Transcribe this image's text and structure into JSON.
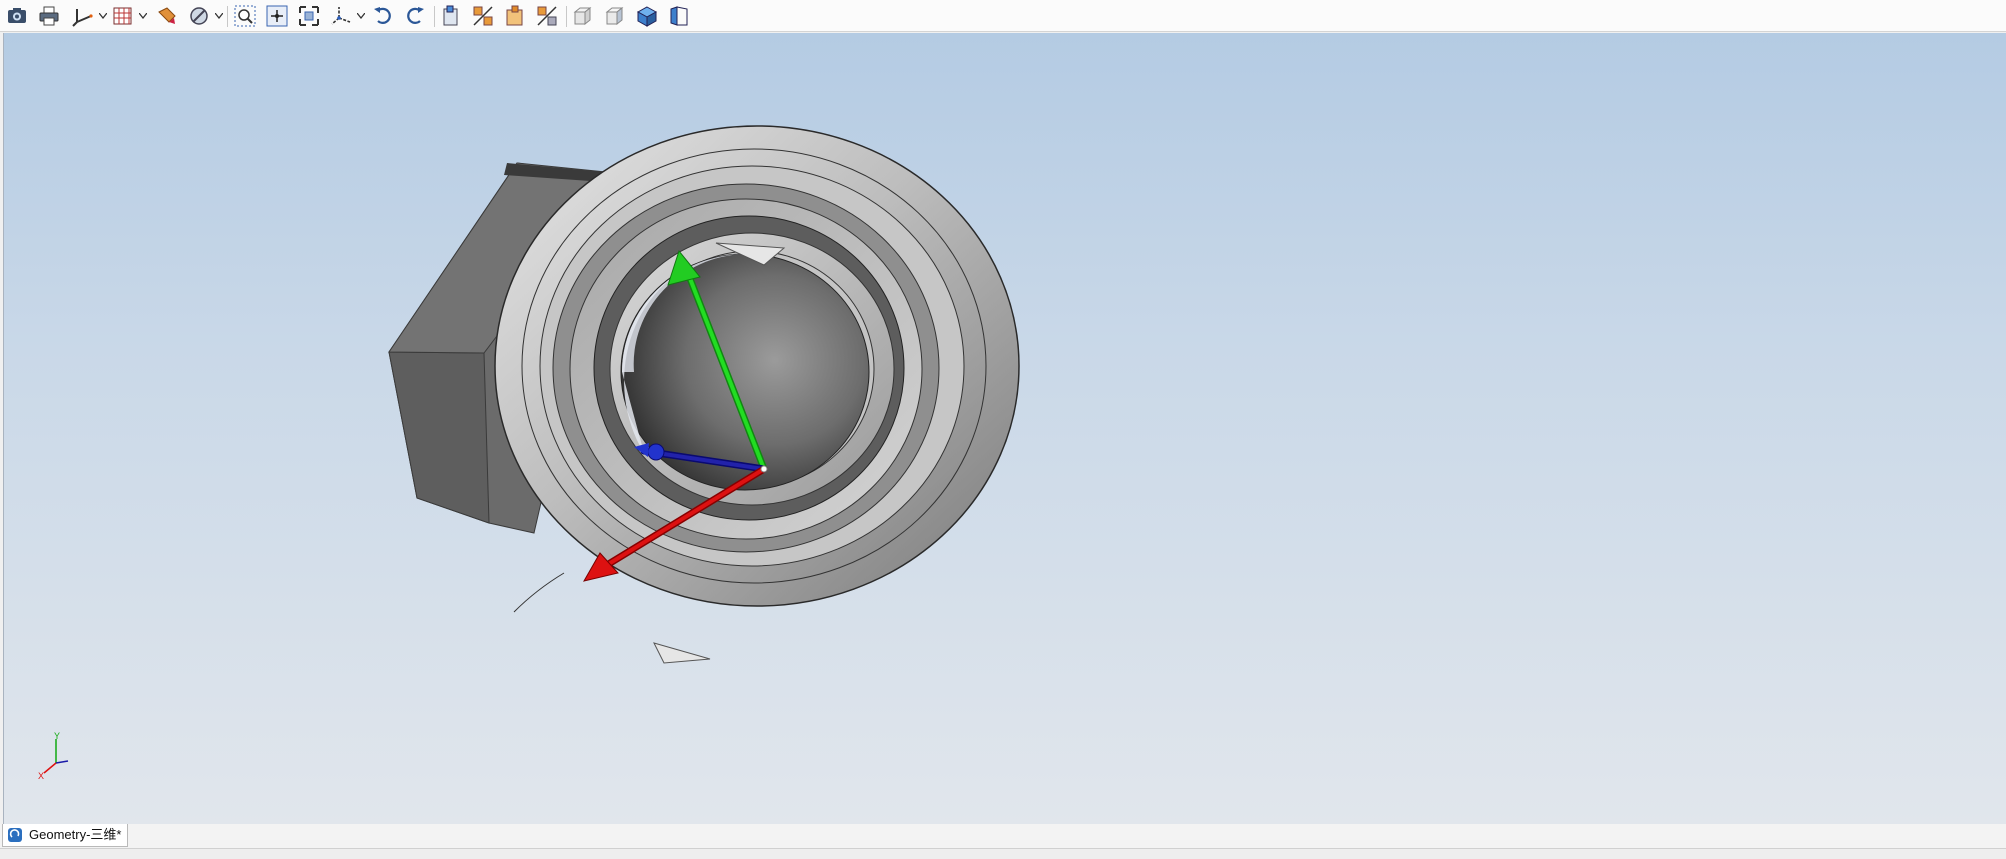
{
  "toolbar": {
    "buttons": [
      {
        "name": "screenshot-camera-icon"
      },
      {
        "name": "print-icon"
      },
      {
        "name": "axis-orientation-icon",
        "dropdown": true
      },
      {
        "name": "mesh-grid-icon",
        "dropdown": true
      },
      {
        "name": "paint-color-icon"
      },
      {
        "name": "section-clip-icon",
        "dropdown": true
      },
      {
        "name": "zoom-window-icon"
      },
      {
        "name": "zoom-fit-icon"
      },
      {
        "name": "zoom-extents-icon"
      },
      {
        "name": "view-axes-icon",
        "dropdown": true
      },
      {
        "name": "undo-icon"
      },
      {
        "name": "redo-icon"
      },
      {
        "name": "view-front-icon"
      },
      {
        "name": "view-section-icon"
      },
      {
        "name": "view-back-icon"
      },
      {
        "name": "view-split-icon"
      },
      {
        "name": "box-view-1-icon"
      },
      {
        "name": "box-view-2-icon"
      },
      {
        "name": "iso-view-icon"
      },
      {
        "name": "ortho-view-icon"
      }
    ]
  },
  "viewport": {
    "background_top": "#b4cbe3",
    "background_bottom": "#e1e6ec",
    "axis_colors": {
      "x": "#dd1111",
      "y": "#11cc11",
      "z": "#1a1aa8"
    },
    "mini_triad": {
      "y_label": "Y",
      "x_label": "X"
    }
  },
  "tabs": [
    {
      "label": "Geometry-三维*",
      "active": true
    }
  ],
  "statusbar": {
    "left": "",
    "middle": "",
    "right": ""
  }
}
